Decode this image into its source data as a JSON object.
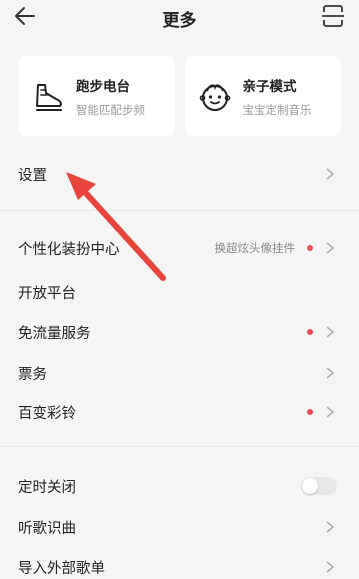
{
  "header": {
    "title": "更多",
    "back_icon": "arrow-left-icon",
    "scan_icon": "scan-icon"
  },
  "cards": [
    {
      "name": "跑步电台",
      "sub": "智能匹配步频",
      "icon": "running-shoe-icon"
    },
    {
      "name": "亲子模式",
      "sub": "宝宝定制音乐",
      "icon": "baby-face-icon"
    }
  ],
  "settings": {
    "label": "设置"
  },
  "menu": [
    {
      "label": "个性化装扮中心",
      "hint": "换超炫头像挂件"
    },
    {
      "label": "开放平台"
    },
    {
      "label": "免流量服务"
    },
    {
      "label": "票务"
    },
    {
      "label": "百变彩铃"
    }
  ],
  "tools": [
    {
      "label": "定时关闭"
    },
    {
      "label": "听歌识曲"
    },
    {
      "label": "导入外部歌单"
    }
  ],
  "colors": {
    "dot": "#ef4d56",
    "annotation_arrow": "#e8443a"
  }
}
